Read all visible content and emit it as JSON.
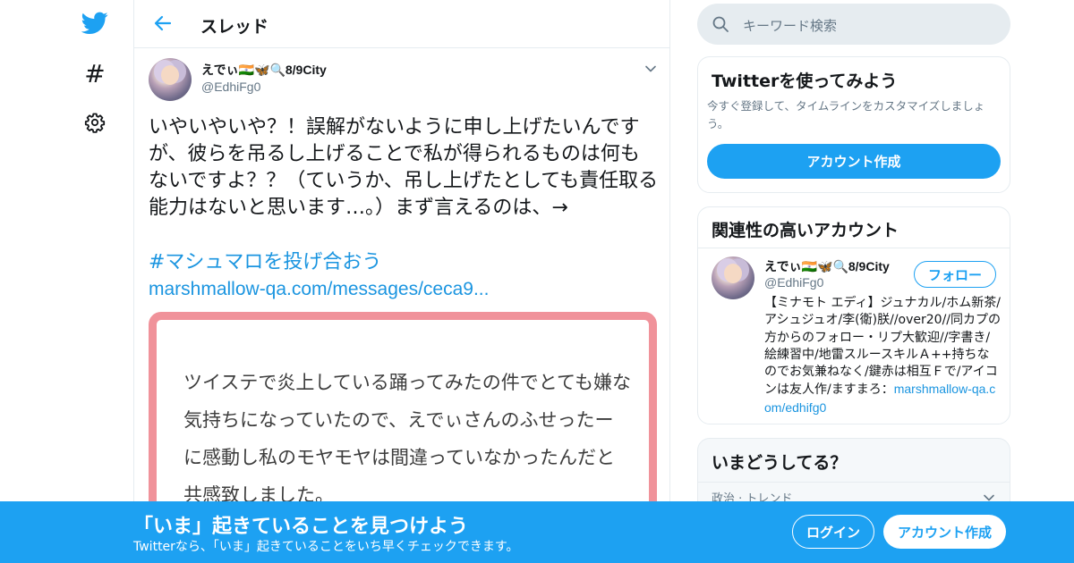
{
  "nav": {
    "icons": [
      "twitter-bird-icon",
      "hashtag-icon",
      "gear-icon"
    ],
    "hashtag_glyph": "#"
  },
  "header": {
    "title": "スレッド"
  },
  "tweet": {
    "name": "えでぃ🇮🇳🦋🔍8/9City",
    "handle": "@EdhiFg0",
    "text": "いやいやいや？！誤解がないように申し上げたいんですが、彼らを吊るし上げることで私が得られるものは何もないですよ？？（ていうか、吊し上げたとしても責任取る能力はないと思います…。）まず言えるのは、→",
    "hashtag": "#マシュマロを投げ合おう",
    "link": "marshmallow-qa.com/messages/ceca9...",
    "card_text": "ツイステで炎上している踊ってみたの件でとても嫌な気持ちになっていたので、えでぃさんのふせったーに感動し私のモヤモヤは間違っていなかったんだと共感致しました。"
  },
  "search": {
    "placeholder": "キーワード検索"
  },
  "try_panel": {
    "title": "Twitterを使ってみよう",
    "description": "今すぐ登録して、タイムラインをカスタマイズしましょう。",
    "button": "アカウント作成"
  },
  "related_panel": {
    "title": "関連性の高いアカウント",
    "account": {
      "name": "えでぃ🇮🇳🦋🔍8/9City",
      "handle": "@EdhiFg0",
      "follow_label": "フォロー",
      "bio": "【ミナモト エディ】ジュナカル/ホム新茶/アシュジュオ/李(衛)朕//over20//同カプの方からのフォロー・リプ大歓迎//字書き/絵練習中/地雷スルースキルＡ++持ちなのでお気兼ねなく/鍵赤は相互Ｆで/アイコンは友人作/ますまろ：",
      "bio_link": "marshmallow-qa.com/edhifg0"
    }
  },
  "now_panel": {
    "title": "いまどうしてる？",
    "row": "政治 · トレンド"
  },
  "banner": {
    "title": "「いま」起きていることを見つけよう",
    "subtitle": "Twitterなら、「いま」起きていることをいち早くチェックできます。",
    "login_label": "ログイン",
    "signup_label": "アカウント作成"
  },
  "colors": {
    "brand": "#1da1f2",
    "link": "#1b95e0",
    "card_border": "#f0929a",
    "muted": "#657786"
  }
}
